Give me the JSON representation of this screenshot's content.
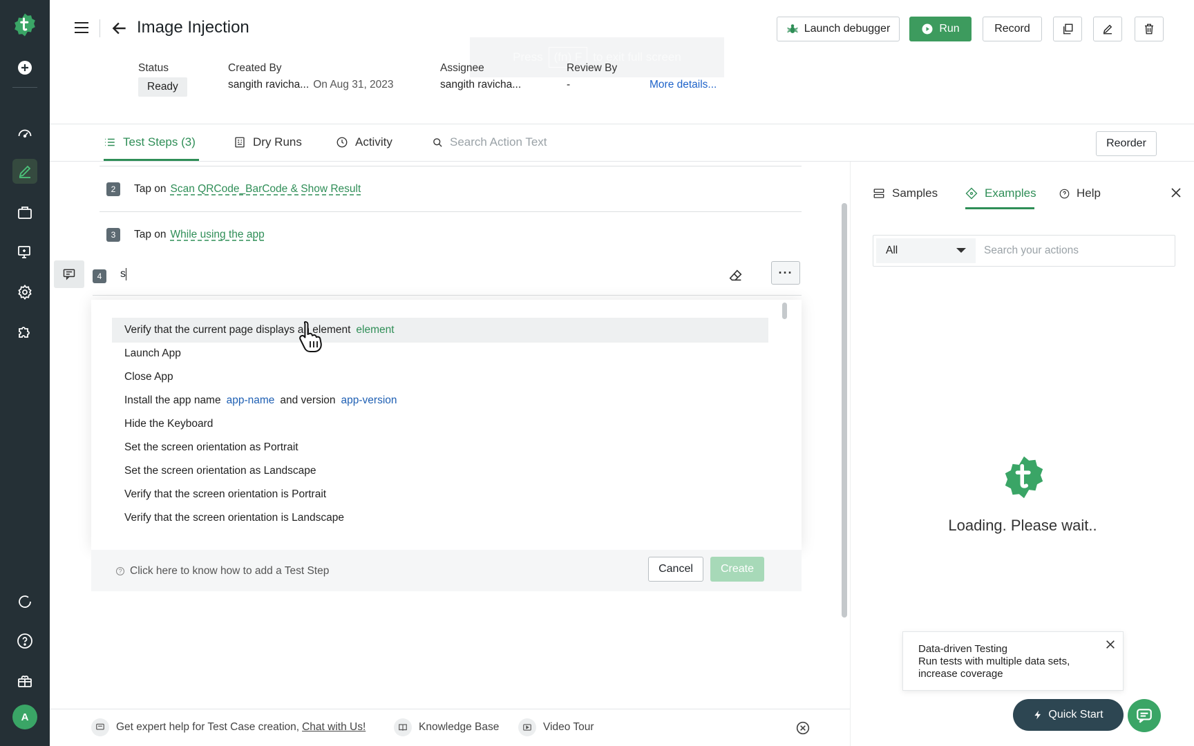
{
  "header": {
    "title": "Image Injection",
    "buttons": {
      "launch_debugger": "Launch debugger",
      "run": "Run",
      "record": "Record"
    },
    "toast": {
      "pre": "Press",
      "key": "(fn) F",
      "post": "to exit full screen"
    },
    "meta": {
      "status_label": "Status",
      "status_value": "Ready",
      "created_by_label": "Created By",
      "created_by_value": "sangith ravicha...",
      "created_date": "On Aug 31, 2023",
      "assignee_label": "Assignee",
      "assignee_value": "sangith ravicha...",
      "review_by_label": "Review By",
      "review_by_value": "-",
      "more_details": "More details..."
    }
  },
  "tabs": {
    "test_steps": "Test Steps (3)",
    "dry_runs": "Dry Runs",
    "activity": "Activity",
    "search_placeholder": "Search Action Text",
    "reorder": "Reorder"
  },
  "steps": [
    {
      "num": "2",
      "prefix": "Tap on",
      "target": "Scan QRCode_BarCode & Show Result"
    },
    {
      "num": "3",
      "prefix": "Tap on",
      "target": "While using the app"
    }
  ],
  "editing_step": {
    "num": "4",
    "typed": "s"
  },
  "suggestions": [
    {
      "text": "Verify that the current page displays an element",
      "param": "element"
    },
    {
      "text": "Launch App"
    },
    {
      "text": "Close App"
    },
    {
      "text": "Install the app name",
      "param": "app-name",
      "mid": "and version",
      "param2": "app-version"
    },
    {
      "text": "Hide the Keyboard"
    },
    {
      "text": "Set the screen orientation as Portrait"
    },
    {
      "text": "Set the screen orientation as Landscape"
    },
    {
      "text": "Verify that the screen orientation is Portrait"
    },
    {
      "text": "Verify that the screen orientation is Landscape"
    }
  ],
  "step_footer": {
    "help": "Click here to know how to add a Test Step",
    "cancel": "Cancel",
    "create": "Create"
  },
  "right_panel": {
    "tabs": {
      "samples": "Samples",
      "examples": "Examples",
      "help": "Help"
    },
    "filter_value": "All",
    "search_placeholder": "Search your actions",
    "loading": "Loading. Please wait.."
  },
  "promo": {
    "title": "Data-driven Testing",
    "body": "Run tests with multiple data sets, increase coverage"
  },
  "quick_start": "Quick Start",
  "bottom_bar": {
    "expert_help": "Get expert help for Test Case creation,",
    "chat_link": "Chat with Us!",
    "knowledge_base": "Knowledge Base",
    "video_tour": "Video Tour"
  },
  "user": {
    "avatar_initial": "A"
  },
  "colors": {
    "brand_green": "#3d9b5e",
    "nav_bg": "#253036",
    "link_blue": "#1e63c9"
  }
}
